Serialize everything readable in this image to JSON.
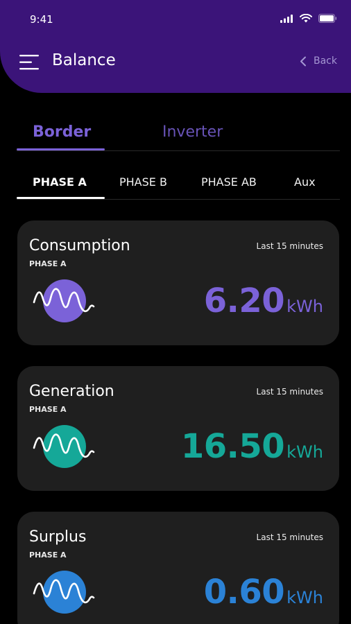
{
  "status_bar": {
    "time": "9:41"
  },
  "header": {
    "title": "Balance",
    "back_label": "Back"
  },
  "main_tabs": [
    {
      "label": "Border",
      "active": true
    },
    {
      "label": "Inverter",
      "active": false
    }
  ],
  "phase_tabs": [
    {
      "label": "PHASE A",
      "active": true
    },
    {
      "label": "PHASE B",
      "active": false
    },
    {
      "label": "PHASE AB",
      "active": false
    },
    {
      "label": "Aux",
      "active": false
    }
  ],
  "cards": [
    {
      "title": "Consumption",
      "phase": "PHASE A",
      "period": "Last 15 minutes",
      "value": "6.20",
      "unit": "kWh",
      "color": "#7b62d8",
      "icon": "wave-purple-icon"
    },
    {
      "title": "Generation",
      "phase": "PHASE A",
      "period": "Last 15 minutes",
      "value": "16.50",
      "unit": "kWh",
      "color": "#15a898",
      "icon": "wave-teal-icon"
    },
    {
      "title": "Surplus",
      "phase": "PHASE A",
      "period": "Last 15 minutes",
      "value": "0.60",
      "unit": "kWh",
      "color": "#2b82d6",
      "icon": "wave-blue-icon"
    }
  ],
  "colors": {
    "header_bg": "#3b1479",
    "accent": "#7b62d8",
    "card_bg": "#1f1f1f"
  }
}
